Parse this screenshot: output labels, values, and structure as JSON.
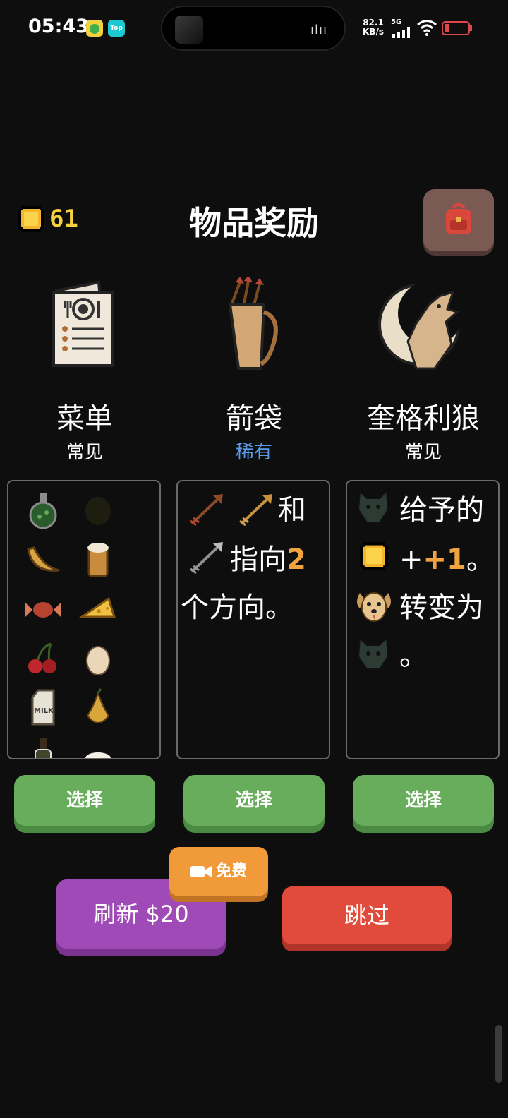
{
  "status_bar": {
    "time": "05:43",
    "net_speed": "82.1",
    "net_unit": "KB/s",
    "signal_label": "5G",
    "app_icons": [
      "cat-app-icon",
      "top-app-icon"
    ],
    "top_app_label": "Top"
  },
  "header": {
    "gold": "61",
    "title": "物品奖励",
    "bag_icon": "backpack-icon"
  },
  "items": [
    {
      "name": "菜单",
      "rarity": "常见",
      "rarity_color": "#ffffff",
      "icon": "menu-icon",
      "description_foods": [
        "potion",
        "lemon",
        "banana",
        "beer",
        "candy",
        "cheese",
        "cherry",
        "egg",
        "milk",
        "pear",
        "wine-bottle",
        "coconut"
      ],
      "milk_label": "MILK",
      "select_label": "选择"
    },
    {
      "name": "箭袋",
      "rarity": "稀有",
      "rarity_color": "#5b9bea",
      "icon": "quiver-icon",
      "desc_and": "和",
      "desc_point": "指向",
      "desc_count": "2",
      "desc_dirs": "个方向。",
      "select_label": "选择"
    },
    {
      "name": "奎格利狼",
      "rarity": "常见",
      "rarity_color": "#ffffff",
      "icon": "wolf-moon-icon",
      "desc_give": "给予的",
      "desc_plus": "+1",
      "desc_period": "。",
      "desc_turn": "转变为",
      "desc_end": "。",
      "select_label": "选择"
    }
  ],
  "actions": {
    "free_label": "免费",
    "refresh_label": "刷新 $20",
    "skip_label": "跳过"
  },
  "colors": {
    "select_green": "#67ad5b",
    "refresh_purple": "#a04ab8",
    "skip_red": "#e04b3b",
    "free_orange": "#f09a3a",
    "gold": "#f4d13c",
    "accent_number": "#f0a341"
  }
}
